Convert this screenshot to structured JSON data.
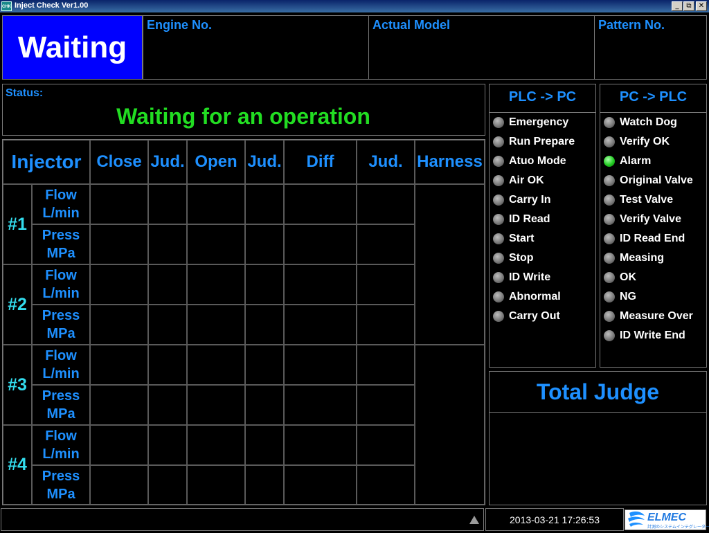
{
  "window": {
    "title": "Inject Check Ver1.00",
    "icon_text": "CHK",
    "buttons": [
      "_",
      "⧉",
      "✕"
    ]
  },
  "header": {
    "status_big": "Waiting",
    "engine_no_label": "Engine No.",
    "actual_model_label": "Actual Model",
    "pattern_no_label": "Pattern No."
  },
  "status": {
    "label": "Status:",
    "text": "Waiting for an operation"
  },
  "table": {
    "columns": [
      "Injector",
      "Close",
      "Jud.",
      "Open",
      "Jud.",
      "Diff",
      "Jud.",
      "Harness"
    ],
    "injectors": [
      {
        "label": "#1",
        "rows": [
          [
            "Flow",
            "L/min"
          ],
          [
            "Press",
            "MPa"
          ]
        ]
      },
      {
        "label": "#2",
        "rows": [
          [
            "Flow",
            "L/min"
          ],
          [
            "Press",
            "MPa"
          ]
        ]
      },
      {
        "label": "#3",
        "rows": [
          [
            "Flow",
            "L/min"
          ],
          [
            "Press",
            "MPa"
          ]
        ]
      },
      {
        "label": "#4",
        "rows": [
          [
            "Flow",
            "L/min"
          ],
          [
            "Press",
            "MPa"
          ]
        ]
      }
    ]
  },
  "plc_to_pc": {
    "title": "PLC -> PC",
    "items": [
      {
        "label": "Emergency",
        "on": false
      },
      {
        "label": "Run Prepare",
        "on": false
      },
      {
        "label": "Atuo Mode",
        "on": false
      },
      {
        "label": "Air OK",
        "on": false
      },
      {
        "label": "Carry In",
        "on": false
      },
      {
        "label": "ID Read",
        "on": false
      },
      {
        "label": "Start",
        "on": false
      },
      {
        "label": "Stop",
        "on": false
      },
      {
        "label": "ID Write",
        "on": false
      },
      {
        "label": "Abnormal",
        "on": false
      },
      {
        "label": "Carry Out",
        "on": false
      }
    ]
  },
  "pc_to_plc": {
    "title": "PC -> PLC",
    "items": [
      {
        "label": "Watch Dog",
        "on": false
      },
      {
        "label": "Verify OK",
        "on": false
      },
      {
        "label": "Alarm",
        "on": true
      },
      {
        "label": "Original Valve",
        "on": false
      },
      {
        "label": "Test Valve",
        "on": false
      },
      {
        "label": "Verify Valve",
        "on": false
      },
      {
        "label": "ID Read End",
        "on": false
      },
      {
        "label": "Measing",
        "on": false
      },
      {
        "label": "OK",
        "on": false
      },
      {
        "label": "NG",
        "on": false
      },
      {
        "label": "Measure Over",
        "on": false
      },
      {
        "label": "ID Write End",
        "on": false
      }
    ]
  },
  "total_judge": {
    "title": "Total Judge"
  },
  "footer": {
    "scroll_icon": "triangle-up-icon",
    "datetime": "2013-03-21 17:26:53",
    "logo_text": "ELMEC",
    "logo_subtext": "計測のシステムインテグレーター"
  },
  "colors": {
    "accent_blue": "#1e90ff",
    "status_green": "#22dd22",
    "waiting_bg": "#0000ff",
    "led_on": "#22cc22"
  }
}
